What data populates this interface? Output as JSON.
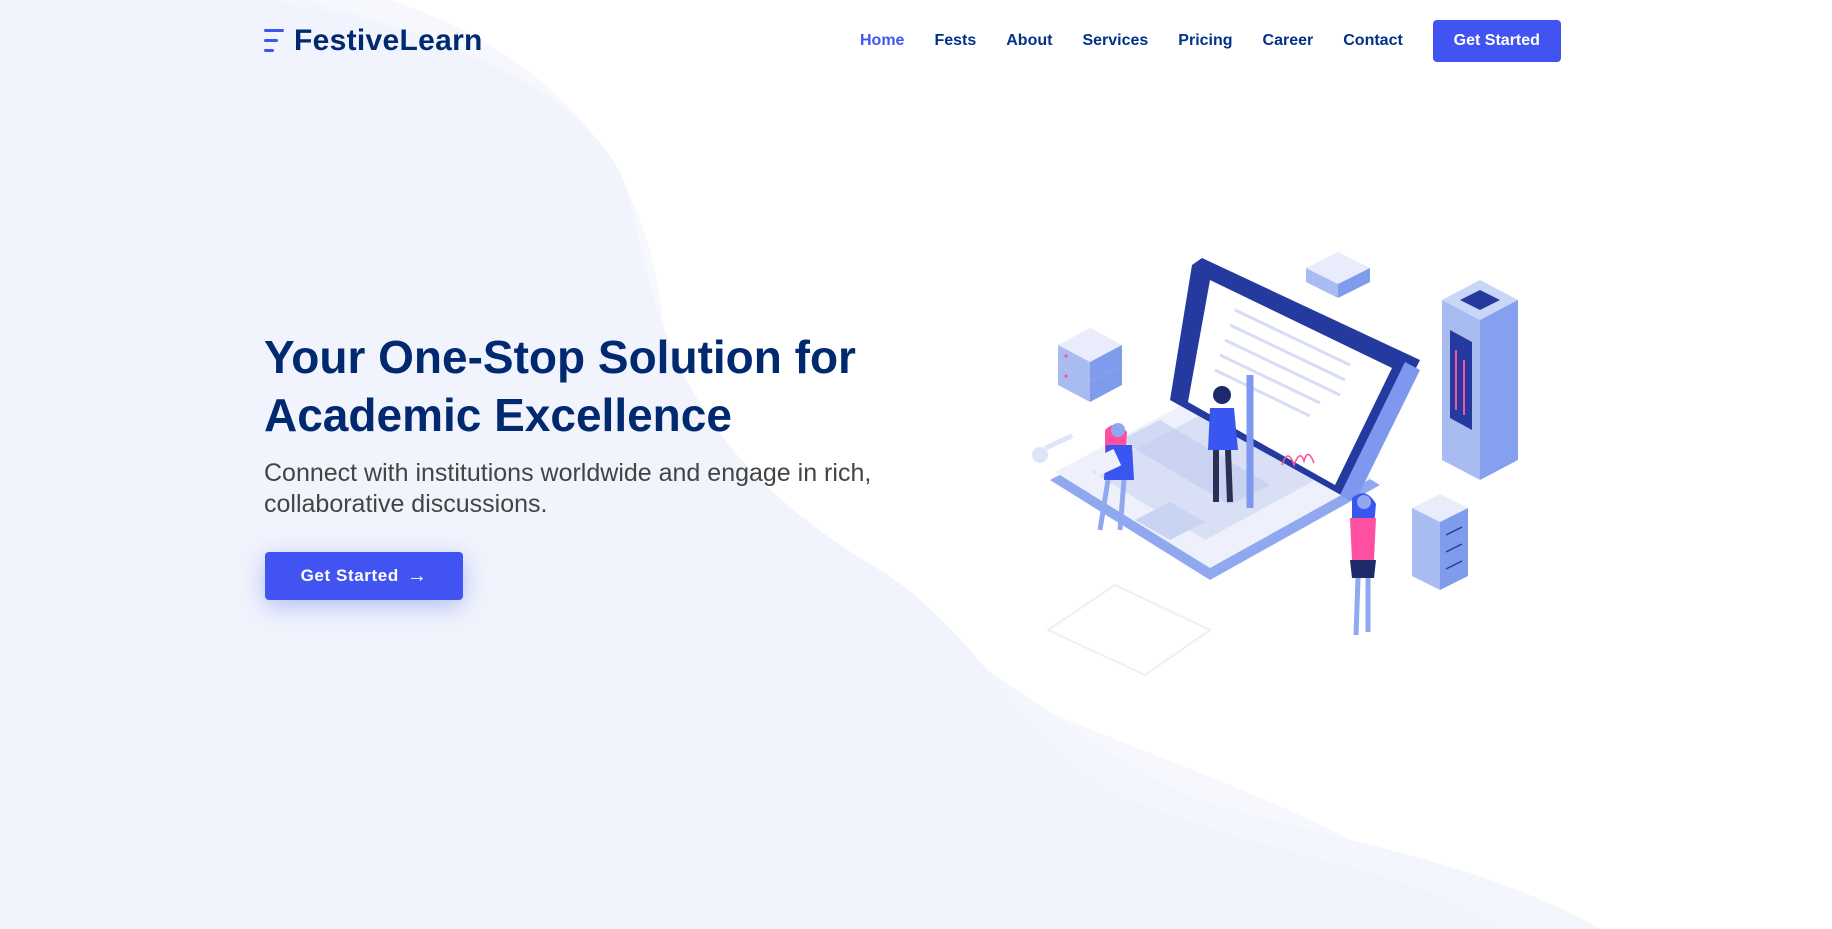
{
  "brand": {
    "name": "FestiveLearn",
    "logo_icon": "menu-lines-icon",
    "accent_color": "#4154f1",
    "heading_color": "#012970"
  },
  "nav": {
    "items": [
      {
        "label": "Home",
        "active": true
      },
      {
        "label": "Fests"
      },
      {
        "label": "About"
      },
      {
        "label": "Services"
      },
      {
        "label": "Pricing"
      },
      {
        "label": "Career"
      },
      {
        "label": "Contact"
      }
    ],
    "cta_label": "Get Started"
  },
  "hero": {
    "title": "Your One-Stop Solution for Academic Excellence",
    "subtitle": "Connect with institutions worldwide and engage in rich, collaborative discussions.",
    "cta_label": "Get Started",
    "cta_icon": "arrow-right-icon",
    "illustration": "isometric-laptop-people-servers-illustration"
  }
}
